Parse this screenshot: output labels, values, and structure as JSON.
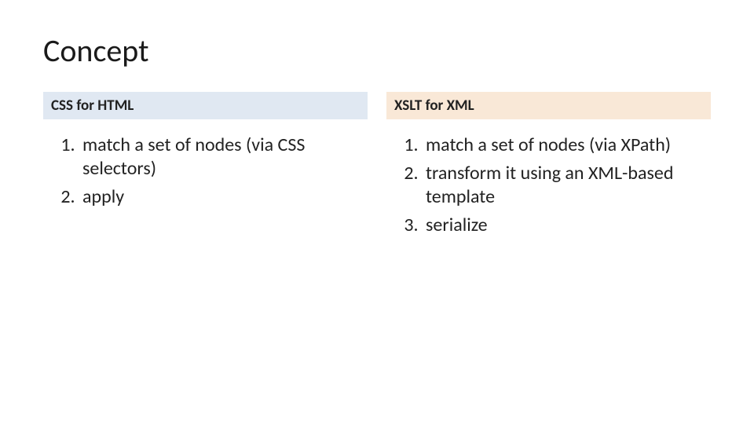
{
  "title": "Concept",
  "left": {
    "heading": "CSS for HTML",
    "items": [
      "match a set of nodes (via CSS selectors)",
      "apply"
    ]
  },
  "right": {
    "heading": "XSLT for XML",
    "items": [
      "match a set of nodes (via XPath)",
      "transform it using an XML-based template",
      "serialize"
    ]
  }
}
